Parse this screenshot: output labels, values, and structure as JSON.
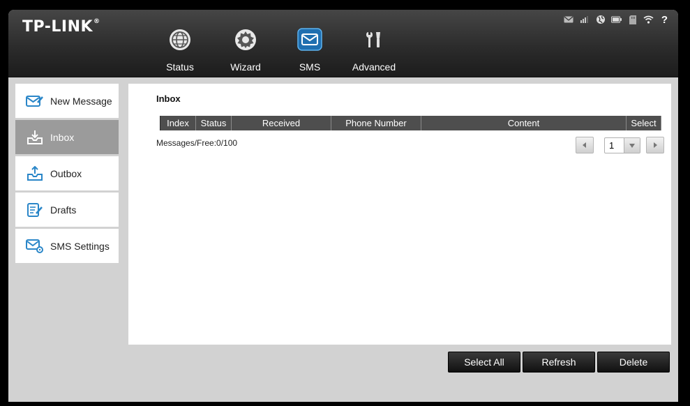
{
  "brand": {
    "logo_text": "TP-LINK",
    "trademark": "®"
  },
  "status_bar": {
    "icons": [
      "envelope-icon",
      "signal-icon",
      "globe-icon",
      "battery-icon",
      "sd-card-icon",
      "wifi-icon",
      "help-icon"
    ],
    "help_label": "?"
  },
  "nav": {
    "items": [
      {
        "label": "Status",
        "icon": "globe-icon"
      },
      {
        "label": "Wizard",
        "icon": "gear-icon"
      },
      {
        "label": "SMS",
        "icon": "envelope-icon",
        "active": true
      },
      {
        "label": "Advanced",
        "icon": "tools-icon"
      }
    ]
  },
  "sidebar": {
    "items": [
      {
        "label": "New Message",
        "icon": "new-message-icon"
      },
      {
        "label": "Inbox",
        "icon": "inbox-icon",
        "active": true
      },
      {
        "label": "Outbox",
        "icon": "outbox-icon"
      },
      {
        "label": "Drafts",
        "icon": "drafts-icon"
      },
      {
        "label": "SMS Settings",
        "icon": "sms-settings-icon"
      }
    ]
  },
  "main": {
    "title": "Inbox",
    "table": {
      "columns": [
        "Index",
        "Status",
        "Received",
        "Phone Number",
        "Content",
        "Select"
      ],
      "rows": []
    },
    "messages_free": "Messages/Free:0/100",
    "pager": {
      "current_page": "1"
    }
  },
  "actions": {
    "select_all": "Select All",
    "refresh": "Refresh",
    "delete": "Delete"
  },
  "colors": {
    "accent": "#3a8fd0",
    "header_bg": "#2c2c2c",
    "active_sidebar": "#9b9b9b"
  }
}
